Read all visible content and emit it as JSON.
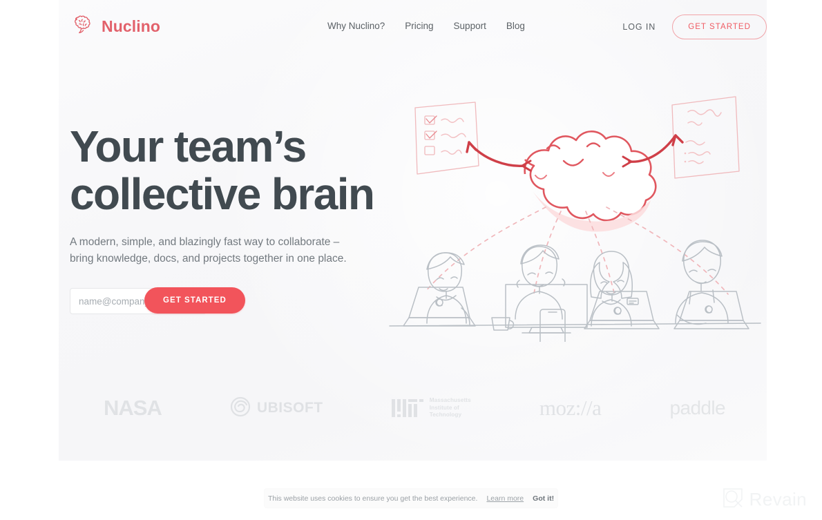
{
  "brand": {
    "name": "Nuclino",
    "logo_icon": "brain-speech-bubble-icon",
    "accent_color": "#f2545b",
    "logo_color": "#e2616b"
  },
  "nav": {
    "items": [
      {
        "label": "Why Nuclino?"
      },
      {
        "label": "Pricing"
      },
      {
        "label": "Support"
      },
      {
        "label": "Blog"
      }
    ],
    "login_label": "LOG IN",
    "cta_label": "GET STARTED"
  },
  "hero": {
    "headline_line1": "Your team’s",
    "headline_line2": "collective brain",
    "subheadline_line1": "A modern, simple, and blazingly fast way to collaborate –",
    "subheadline_line2": "bring knowledge, docs, and projects together in one place.",
    "email_placeholder": "name@company.com",
    "email_value": "",
    "cta_label": "GET STARTED",
    "illustration": "smiling-cloud-brain-with-team-at-laptops"
  },
  "logos": {
    "items": [
      {
        "name": "nasa-logo",
        "text": "NASA"
      },
      {
        "name": "ubisoft-logo",
        "text": "UBISOFT"
      },
      {
        "name": "mit-logo",
        "text": "MIT",
        "line1": "Massachusetts",
        "line2": "Institute of",
        "line3": "Technology"
      },
      {
        "name": "mozilla-logo",
        "text": "moz://a"
      },
      {
        "name": "paddle-logo",
        "text": "paddle"
      }
    ]
  },
  "cookie": {
    "message": "This website uses cookies to ensure you get the best experience.",
    "link_label": "Learn more",
    "accept_label": "Got it!"
  },
  "watermark": {
    "text": "Revain",
    "icon": "revain-logo-icon"
  }
}
